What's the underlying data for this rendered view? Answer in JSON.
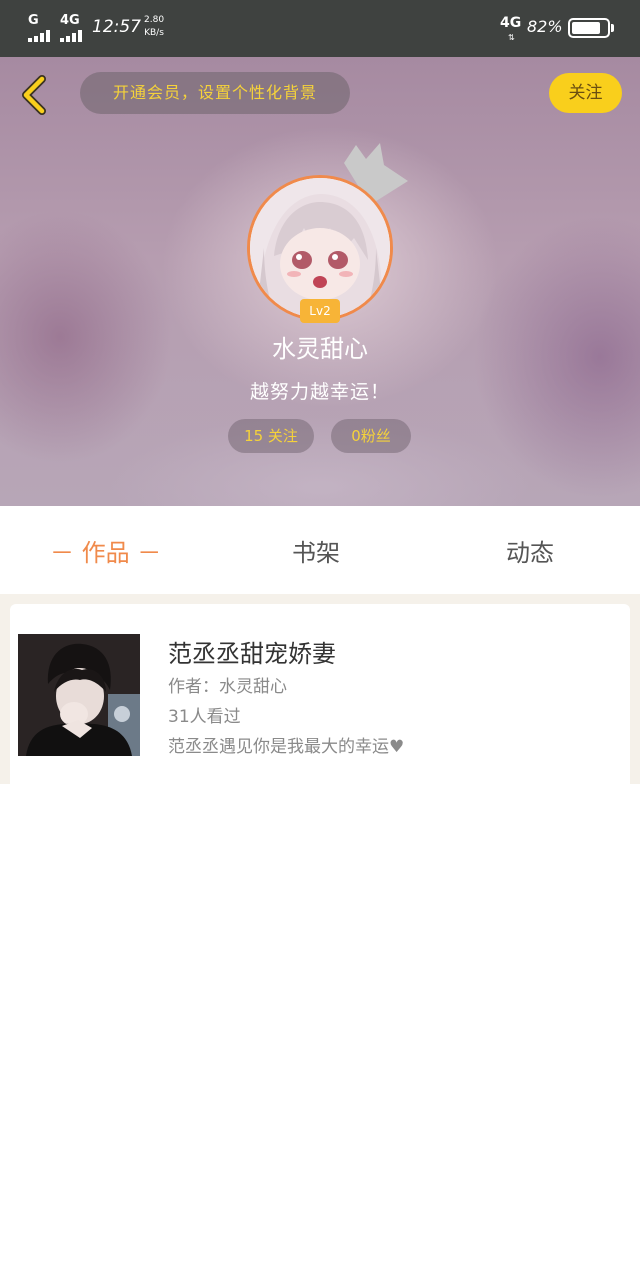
{
  "status_bar": {
    "sim1_network": "G",
    "sim2_network": "4G",
    "time": "12:57",
    "net_speed_value": "2.80",
    "net_speed_unit": "KB/s",
    "mobile_data": "4G",
    "battery_percent": "82%",
    "battery_level": 0.82
  },
  "header": {
    "vip_banner": "开通会员，设置个性化背景",
    "follow_button": "关注",
    "level_badge": "Lv2",
    "username": "水灵甜心",
    "motto": "越努力越幸运！",
    "following_stat": "15 关注",
    "fans_stat": "0粉丝"
  },
  "tabs": {
    "works": "－ 作品 －",
    "bookshelf": "书架",
    "moments": "动态"
  },
  "works": [
    {
      "title": "范丞丞甜宠娇妻",
      "author": "作者：水灵甜心",
      "views": "31人看过",
      "description": "范丞丞遇见你是我最大的幸运♥"
    }
  ],
  "colors": {
    "accent_orange": "#f08a4b",
    "follow_yellow": "#f9cf1c",
    "vip_text_yellow": "#f5d23a",
    "status_bar_bg": "#3f4240"
  }
}
